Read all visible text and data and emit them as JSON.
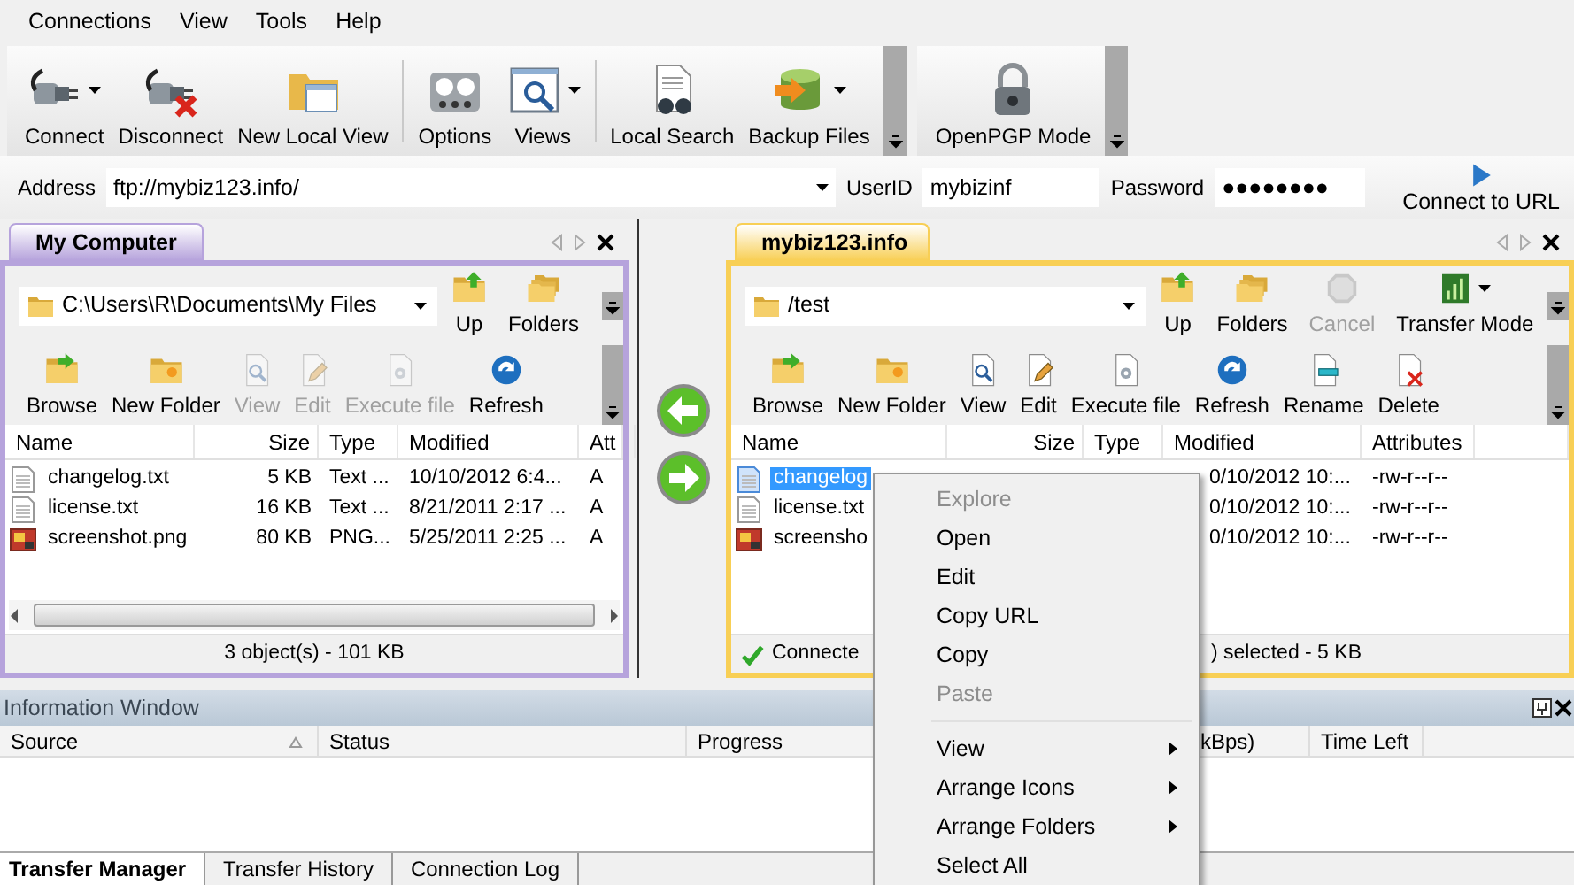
{
  "menu": [
    "Connections",
    "View",
    "Tools",
    "Help"
  ],
  "toolbars": [
    {
      "groups": [
        [
          {
            "label": "Connect",
            "dropdown": true
          },
          {
            "label": "Disconnect",
            "dropdown": false
          },
          {
            "label": "New Local View",
            "dropdown": false
          }
        ],
        [
          {
            "label": "Options",
            "dropdown": false
          },
          {
            "label": "Views",
            "dropdown": true
          }
        ],
        [
          {
            "label": "Local Search",
            "dropdown": false
          },
          {
            "label": "Backup Files",
            "dropdown": true
          }
        ]
      ]
    },
    {
      "groups": [
        [
          {
            "label": "OpenPGP Mode",
            "dropdown": false
          }
        ]
      ]
    }
  ],
  "address_bar": {
    "address_label": "Address",
    "address": "ftp://mybiz123.info/",
    "user_label": "UserID",
    "user": "mybizinf",
    "password_label": "Password",
    "password": "●●●●●●●●",
    "connect_button": "Connect to URL"
  },
  "panes": [
    {
      "title": "My Computer",
      "color": "#b6a3dc",
      "path": "C:\\Users\\R\\Documents\\My Files",
      "hscroll": true,
      "nav": [
        {
          "label": "Up",
          "disabled": false,
          "dropdown": false
        },
        {
          "label": "Folders",
          "disabled": false,
          "dropdown": false
        }
      ],
      "actions": [
        {
          "label": "Browse",
          "disabled": false
        },
        {
          "label": "New Folder",
          "disabled": false
        },
        {
          "label": "View",
          "disabled": true
        },
        {
          "label": "Edit",
          "disabled": true
        },
        {
          "label": "Execute file",
          "disabled": true
        },
        {
          "label": "Refresh",
          "disabled": false
        }
      ],
      "columns": [
        "Name",
        "Size",
        "Type",
        "Modified",
        "Att"
      ],
      "rows": [
        {
          "kind": "text",
          "name": "changelog.txt",
          "size": "5 KB",
          "type": "Text ...",
          "modified": "10/10/2012 6:4...",
          "attributes": "A",
          "selected": false
        },
        {
          "kind": "text",
          "name": "license.txt",
          "size": "16 KB",
          "type": "Text ...",
          "modified": "8/21/2011 2:17 ...",
          "attributes": "A",
          "selected": false
        },
        {
          "kind": "image",
          "name": "screenshot.png",
          "size": "80 KB",
          "type": "PNG...",
          "modified": "5/25/2011 2:25 ...",
          "attributes": "A",
          "selected": false
        }
      ],
      "status": [
        {
          "kind": "plain",
          "text": "3 object(s) - 101 KB"
        }
      ]
    },
    {
      "title": "mybiz123.info",
      "color": "#f8cf55",
      "path": "/test",
      "hscroll": false,
      "nav": [
        {
          "label": "Up",
          "disabled": false,
          "dropdown": false
        },
        {
          "label": "Folders",
          "disabled": false,
          "dropdown": false
        },
        {
          "label": "Cancel",
          "disabled": true,
          "dropdown": false
        },
        {
          "label": "Transfer Mode",
          "disabled": false,
          "dropdown": true
        }
      ],
      "actions": [
        {
          "label": "Browse",
          "disabled": false
        },
        {
          "label": "New Folder",
          "disabled": false
        },
        {
          "label": "View",
          "disabled": false
        },
        {
          "label": "Edit",
          "disabled": false
        },
        {
          "label": "Execute file",
          "disabled": false
        },
        {
          "label": "Refresh",
          "disabled": false
        },
        {
          "label": "Rename",
          "disabled": false
        },
        {
          "label": "Delete",
          "disabled": false
        }
      ],
      "columns": [
        "Name",
        "Size",
        "Type",
        "Modified",
        "Attributes"
      ],
      "rows": [
        {
          "kind": "text",
          "name": "changelog",
          "modified": "0/10/2012 10:...",
          "attributes": "-rw-r--r--",
          "selected": true
        },
        {
          "kind": "text",
          "name": "license.txt",
          "modified": "0/10/2012 10:...",
          "attributes": "-rw-r--r--",
          "selected": false
        },
        {
          "kind": "image",
          "name": "screensho",
          "modified": "0/10/2012 10:...",
          "attributes": "-rw-r--r--",
          "selected": false
        }
      ],
      "status": [
        {
          "kind": "connected",
          "text": "Connecte"
        },
        {
          "kind": "plain",
          "text": ") selected - 5 KB"
        }
      ]
    }
  ],
  "information_window": {
    "title": "Information Window",
    "columns": [
      {
        "label": "Source",
        "sorted": true
      },
      {
        "label": "Status",
        "sorted": false
      },
      {
        "label": "Progress",
        "sorted": false
      },
      {
        "label": "kBps)",
        "sorted": false
      },
      {
        "label": "Time Left",
        "sorted": false
      }
    ],
    "tabs": [
      {
        "label": "Transfer Manager",
        "selected": true
      },
      {
        "label": "Transfer History",
        "selected": false
      },
      {
        "label": "Connection Log",
        "selected": false
      }
    ]
  },
  "context_menu": [
    {
      "kind": "item",
      "label": "Explore",
      "disabled": true,
      "submenu": false
    },
    {
      "kind": "item",
      "label": "Open",
      "disabled": false,
      "submenu": false
    },
    {
      "kind": "item",
      "label": "Edit",
      "disabled": false,
      "submenu": false
    },
    {
      "kind": "item",
      "label": "Copy URL",
      "disabled": false,
      "submenu": false
    },
    {
      "kind": "item",
      "label": "Copy",
      "disabled": false,
      "submenu": false
    },
    {
      "kind": "item",
      "label": "Paste",
      "disabled": true,
      "submenu": false
    },
    {
      "kind": "separator"
    },
    {
      "kind": "item",
      "label": "View",
      "disabled": false,
      "submenu": true
    },
    {
      "kind": "item",
      "label": "Arrange Icons",
      "disabled": false,
      "submenu": true
    },
    {
      "kind": "item",
      "label": "Arrange Folders",
      "disabled": false,
      "submenu": true
    },
    {
      "kind": "item",
      "label": "Select All",
      "disabled": false,
      "submenu": false
    }
  ]
}
